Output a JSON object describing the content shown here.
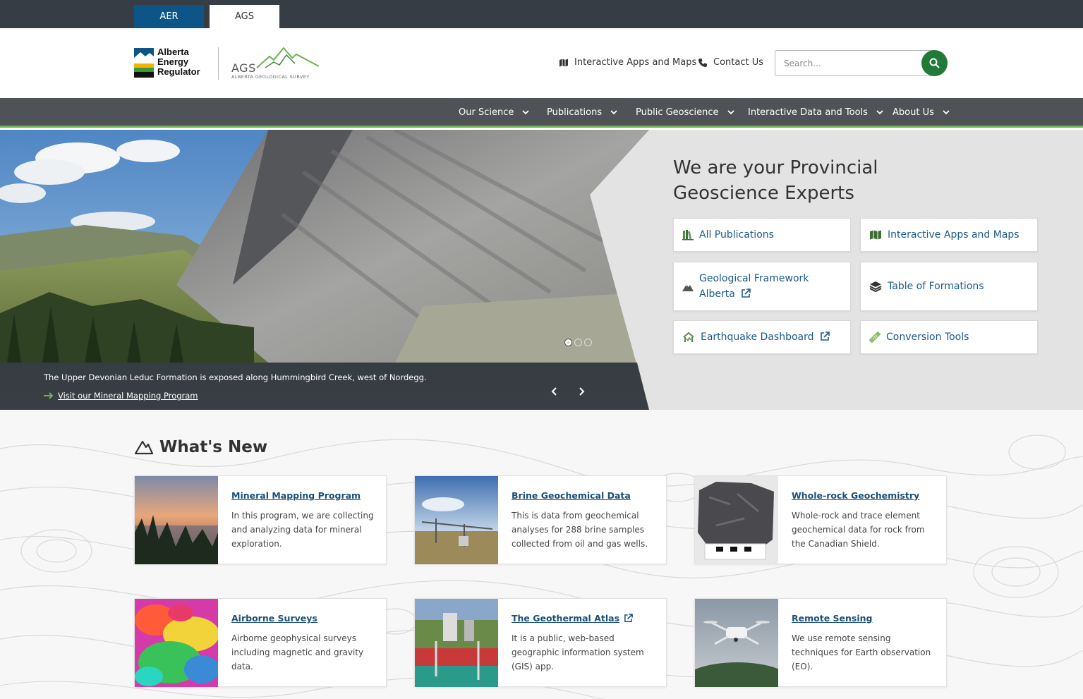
{
  "top_tabs": [
    "AER",
    "AGS"
  ],
  "header": {
    "aer_logo_lines": [
      "Alberta",
      "Energy",
      "Regulator"
    ],
    "ags_logo_word": "AGS",
    "ags_logo_sub": "ALBERTA GEOLOGICAL SURVEY",
    "apps_link": "Interactive Apps and Maps",
    "contact_link": "Contact Us",
    "search_placeholder": "Search..."
  },
  "nav": [
    "Our Science",
    "Publications",
    "Public Geoscience",
    "Interactive Data and Tools",
    "About Us"
  ],
  "hero": {
    "caption": "The Upper Devonian Leduc Formation is exposed along Hummingbird Creek, west of Nordegg.",
    "caption_link": "Visit our Mineral Mapping Program",
    "title": "We are your Provincial Geoscience Experts",
    "quick_links": {
      "all_publications": "All Publications",
      "apps_maps": "Interactive Apps and Maps",
      "geo_framework_1": "Geological Framework",
      "geo_framework_2": "Alberta",
      "table_formations": "Table of Formations",
      "earthquake": "Earthquake Dashboard",
      "conversion": "Conversion Tools"
    },
    "carousel_slides": 3,
    "active_slide": 1
  },
  "whats_new": {
    "title": "What's New",
    "cards": [
      {
        "title": "Mineral Mapping Program",
        "desc": "In this program, we are collecting and analyzing data for mineral exploration."
      },
      {
        "title": "Brine Geochemical Data",
        "desc": "This is data from geochemical analyses for 288 brine samples collected from oil and gas wells."
      },
      {
        "title": "Whole-rock Geochemistry",
        "desc": "Whole-rock and trace element geochemical data for rock from the Canadian Shield."
      },
      {
        "title": "Airborne Surveys",
        "desc": "Airborne geophysical surveys including magnetic and gravity data."
      },
      {
        "title": "The Geothermal Atlas",
        "desc": "It is a public, web-based geographic information system (GIS) app."
      },
      {
        "title": "Remote Sensing",
        "desc": "We use remote sensing techniques for Earth observation (EO)."
      }
    ]
  },
  "colors": {
    "aer_blue": "#0d5487",
    "green_accent": "#227a3a",
    "nav_bg": "#4f5257",
    "link_blue": "#1b5a8a"
  }
}
